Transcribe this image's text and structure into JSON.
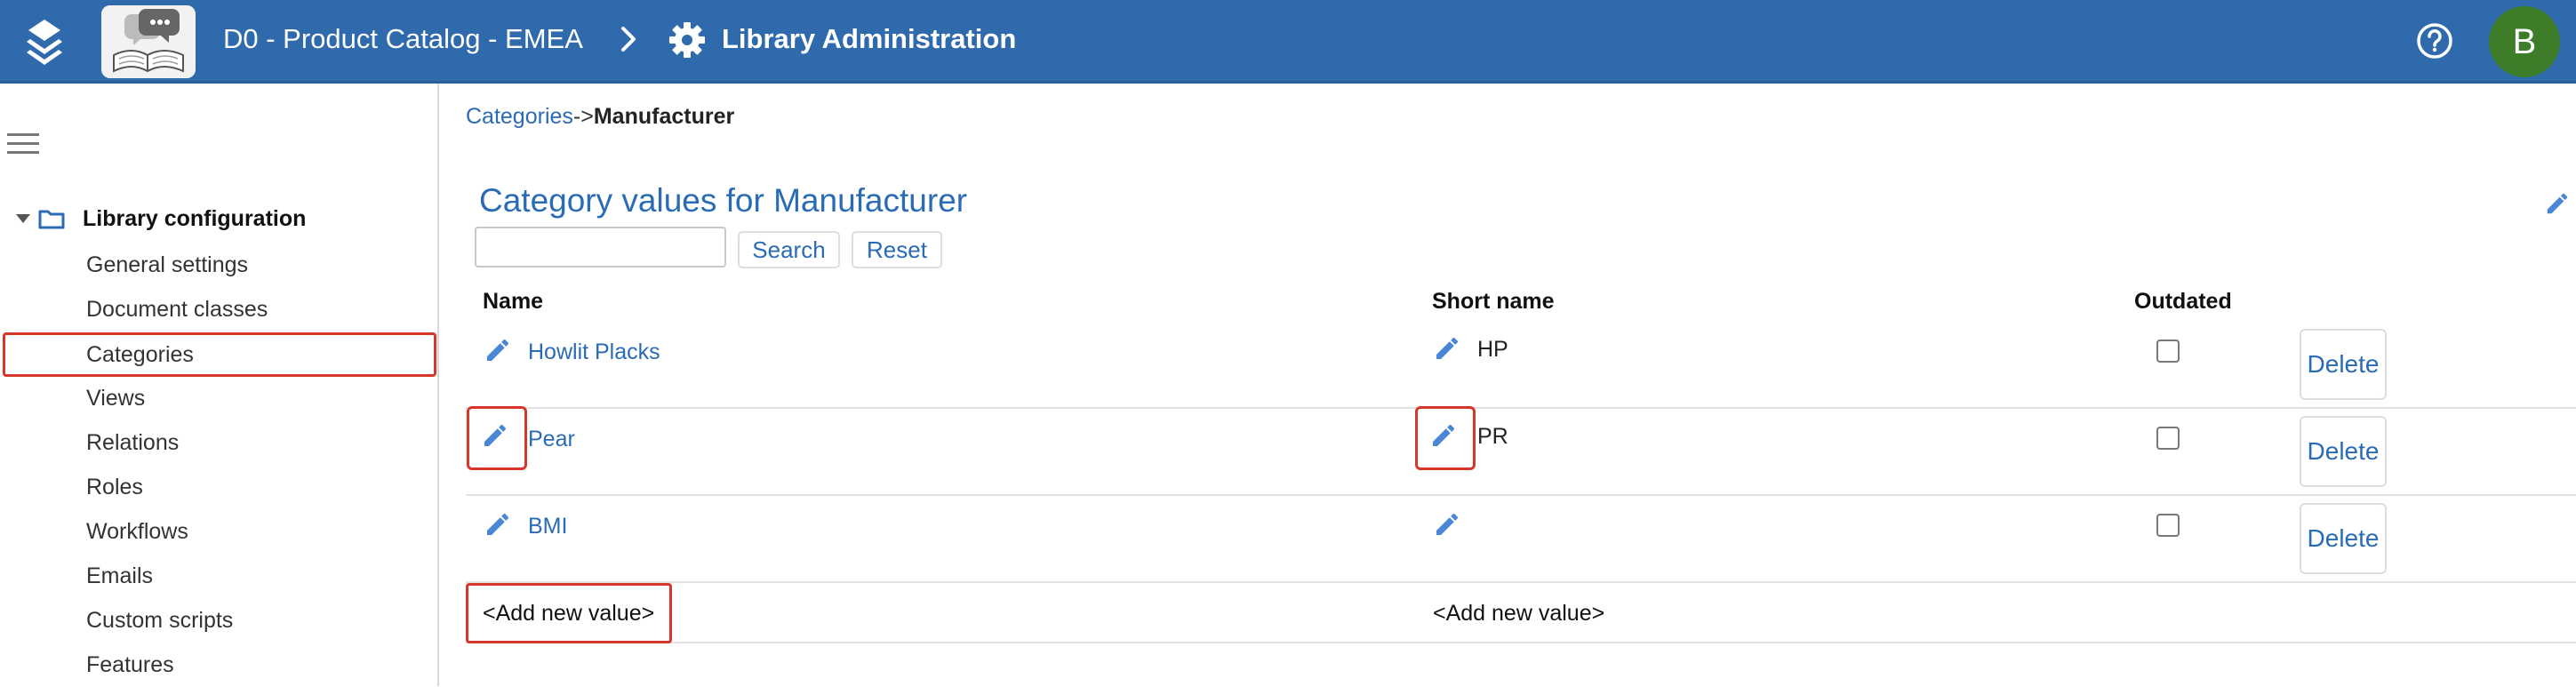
{
  "header": {
    "app_title": "D0 - Product Catalog - EMEA",
    "section_title": "Library Administration",
    "avatar_initial": "B",
    "bg_color": "#2f6aad"
  },
  "sidebar": {
    "group_label": "Library configuration",
    "items": [
      {
        "label": "General settings"
      },
      {
        "label": "Document classes"
      },
      {
        "label": "Categories",
        "active": true
      },
      {
        "label": "Views"
      },
      {
        "label": "Relations"
      },
      {
        "label": "Roles"
      },
      {
        "label": "Workflows"
      },
      {
        "label": "Emails"
      },
      {
        "label": "Custom scripts"
      },
      {
        "label": "Features"
      }
    ]
  },
  "breadcrumb": {
    "parent": "Categories",
    "separator": "->",
    "current": "Manufacturer"
  },
  "main": {
    "title": "Category values for Manufacturer",
    "search": {
      "value": "",
      "placeholder": ""
    },
    "search_label": "Search",
    "reset_label": "Reset",
    "columns": {
      "name": "Name",
      "short_name": "Short name",
      "outdated": "Outdated"
    },
    "rows": [
      {
        "name": "Howlit Placks",
        "short_name": "HP",
        "outdated": false,
        "delete_label": "Delete"
      },
      {
        "name": "Pear",
        "short_name": "PR",
        "outdated": false,
        "delete_label": "Delete"
      },
      {
        "name": "BMI",
        "short_name": "",
        "outdated": false,
        "delete_label": "Delete"
      }
    ],
    "add_new_name": "<Add new value>",
    "add_new_short": "<Add new value>"
  },
  "colors": {
    "accent": "#2a6bb5",
    "highlight": "#d9362b",
    "avatar": "#3d7d2a"
  }
}
